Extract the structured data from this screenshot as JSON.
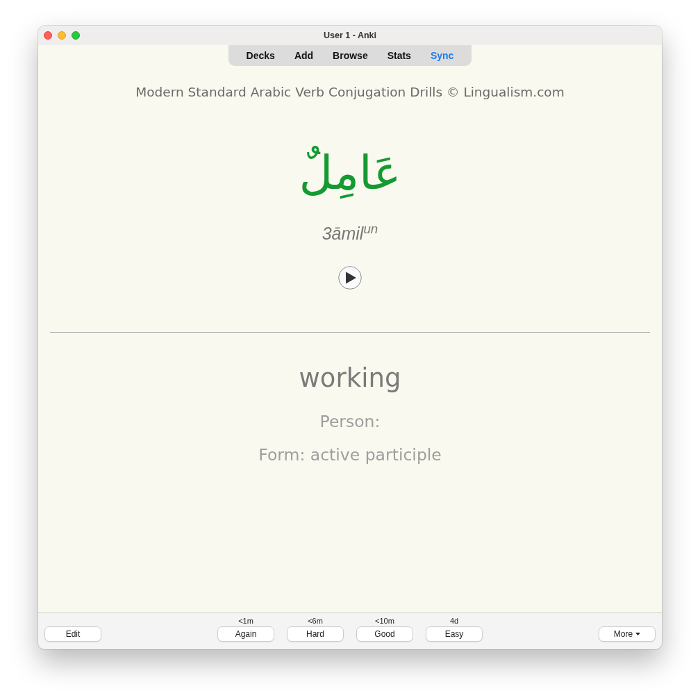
{
  "window": {
    "title": "User 1 - Anki"
  },
  "toolbar": {
    "items": [
      {
        "label": "Decks",
        "highlighted": false
      },
      {
        "label": "Add",
        "highlighted": false
      },
      {
        "label": "Browse",
        "highlighted": false
      },
      {
        "label": "Stats",
        "highlighted": false
      },
      {
        "label": "Sync",
        "highlighted": true
      }
    ]
  },
  "card": {
    "header": "Modern Standard Arabic Verb Conjugation Drills © Lingualism.com",
    "arabic": "عَامِلٌ",
    "transliteration": "3āmil$^{un}$",
    "answer": "working",
    "person": "Person:",
    "form": "Form: active participle"
  },
  "bottom_bar": {
    "edit": "Edit",
    "answers": [
      {
        "interval": "<1m",
        "label": "Again"
      },
      {
        "interval": "<6m",
        "label": "Hard"
      },
      {
        "interval": "<10m",
        "label": "Good"
      },
      {
        "interval": "4d",
        "label": "Easy"
      }
    ],
    "more": "More"
  }
}
